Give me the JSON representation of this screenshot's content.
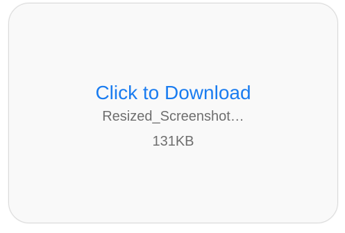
{
  "attachment": {
    "action_label": "Click to Download",
    "filename": "Resized_Screenshot…",
    "size": "131KB"
  },
  "colors": {
    "link": "#1a7cf0",
    "secondary_text": "#6e6e6e",
    "card_background": "#f9f9f9",
    "card_border": "#dadada"
  }
}
